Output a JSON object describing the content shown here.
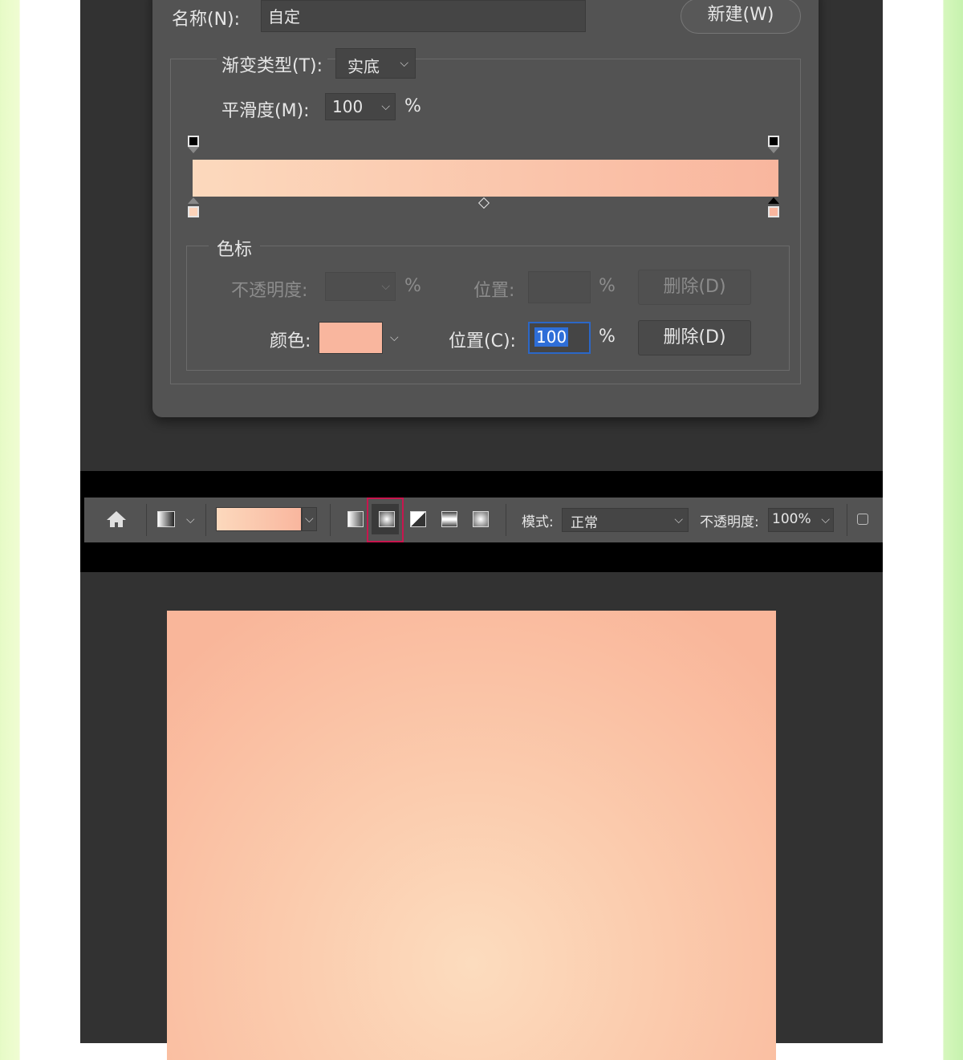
{
  "dialog": {
    "name_label": "名称(N):",
    "name_value": "自定",
    "new_button": "新建(W)",
    "type_label": "渐变类型(T):",
    "type_value": "实底",
    "smooth_label": "平滑度(M):",
    "smooth_value": "100",
    "percent": "%",
    "gradient_colors": {
      "start": "#fcd9bd",
      "end": "#f9b69e"
    }
  },
  "stops": {
    "group_title": "色标",
    "opacity_label": "不透明度:",
    "opacity_position_label": "位置:",
    "delete_disabled": "删除(D)",
    "color_label": "颜色:",
    "color_swatch": "#f9b69e",
    "position_label": "位置(C):",
    "position_value": "100",
    "delete_button": "删除(D)"
  },
  "optionsbar": {
    "mode_label": "模式:",
    "mode_value": "正常",
    "opacity_label": "不透明度:",
    "opacity_value": "100%",
    "highlight_color": "#c8164e"
  }
}
